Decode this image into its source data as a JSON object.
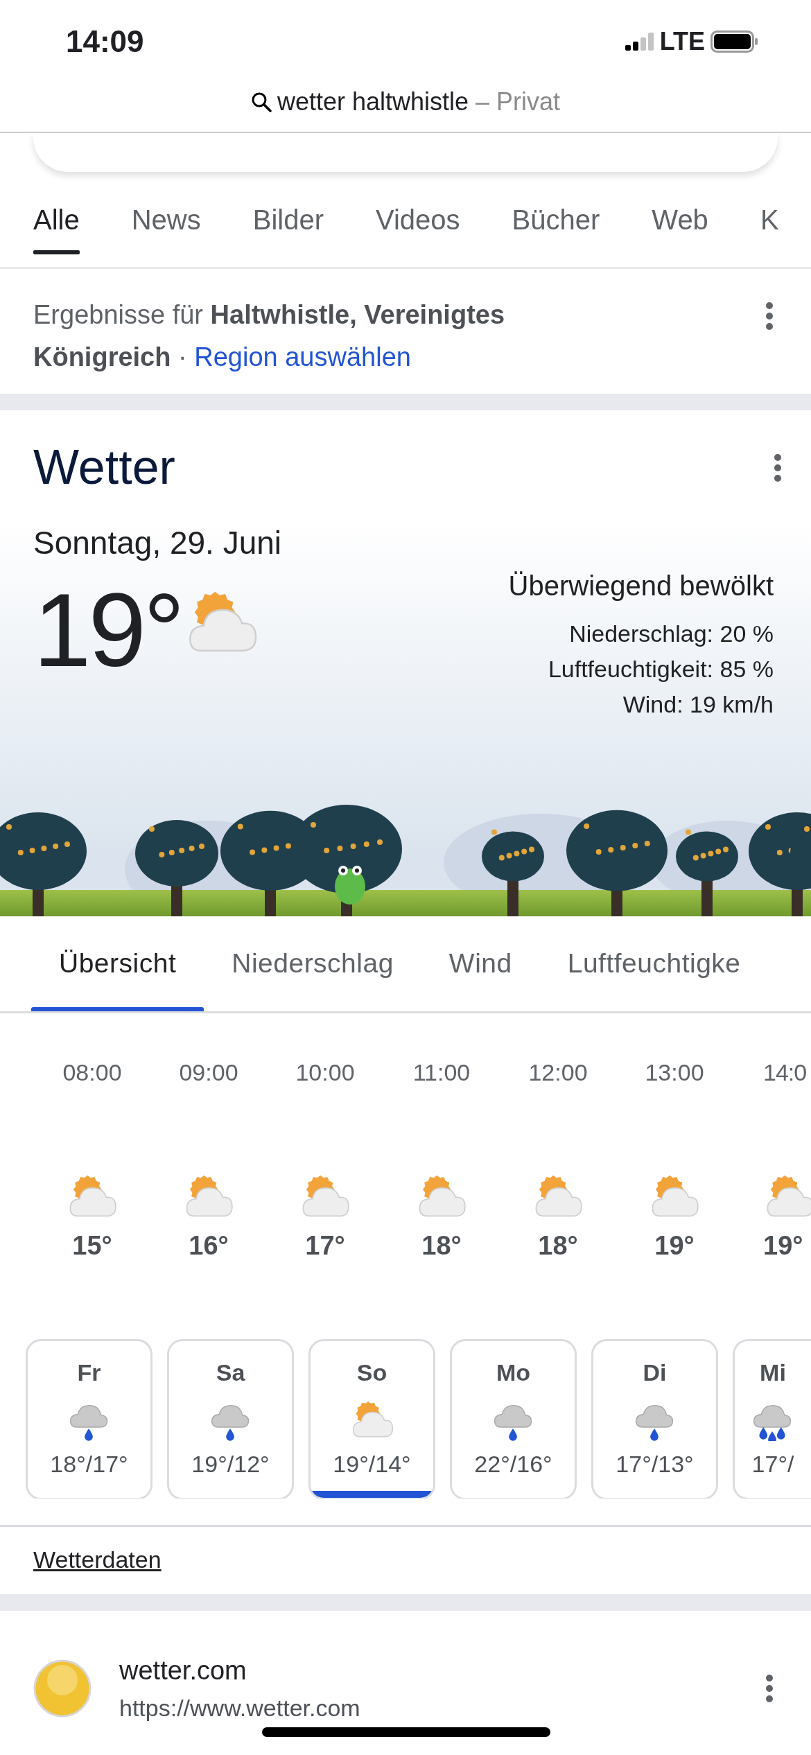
{
  "status_bar": {
    "time": "14:09",
    "network": "LTE"
  },
  "address_bar": {
    "query": "wetter haltwhistle",
    "mode": "– Privat"
  },
  "search_tabs": [
    {
      "label": "Alle",
      "selected": true
    },
    {
      "label": "News",
      "selected": false
    },
    {
      "label": "Bilder",
      "selected": false
    },
    {
      "label": "Videos",
      "selected": false
    },
    {
      "label": "Bücher",
      "selected": false
    },
    {
      "label": "Web",
      "selected": false
    },
    {
      "label": "K",
      "selected": false
    }
  ],
  "results_note": {
    "text": "Ergebnisse für **Haltwhistle, Vereinigtes Königreich** · ",
    "link": "Region auswählen"
  },
  "weather": {
    "title": "Wetter",
    "date": "Sonntag, 29. Juni",
    "temperature": "19°",
    "kind": "partly_cloudy",
    "condition": "Überwiegend bewölkt",
    "details": [
      "Niederschlag: 20 %",
      "Luftfeuchtigkeit: 85 %",
      "Wind: 19 km/h"
    ],
    "tabs": [
      {
        "label": "Übersicht",
        "selected": true
      },
      {
        "label": "Niederschlag",
        "selected": false
      },
      {
        "label": "Wind",
        "selected": false
      },
      {
        "label": "Luftfeuchtigke",
        "selected": false
      }
    ],
    "hourly": [
      {
        "time": "08:00",
        "kind": "partly_cloudy",
        "temp": "15°"
      },
      {
        "time": "09:00",
        "kind": "partly_cloudy",
        "temp": "16°"
      },
      {
        "time": "10:00",
        "kind": "partly_cloudy",
        "temp": "17°"
      },
      {
        "time": "11:00",
        "kind": "partly_cloudy",
        "temp": "18°"
      },
      {
        "time": "12:00",
        "kind": "partly_cloudy",
        "temp": "18°"
      },
      {
        "time": "13:00",
        "kind": "partly_cloudy",
        "temp": "19°"
      },
      {
        "time": "14:0",
        "kind": "partly_cloudy",
        "temp": "19°"
      }
    ],
    "days": [
      {
        "day": "Fr",
        "kind": "rain",
        "temps": "18°/17°",
        "selected": false
      },
      {
        "day": "Sa",
        "kind": "rain",
        "temps": "19°/12°",
        "selected": false
      },
      {
        "day": "So",
        "kind": "partly_cloudy",
        "temps": "19°/14°",
        "selected": true
      },
      {
        "day": "Mo",
        "kind": "rain",
        "temps": "22°/16°",
        "selected": false
      },
      {
        "day": "Di",
        "kind": "rain",
        "temps": "17°/13°",
        "selected": false
      },
      {
        "day": "Mi",
        "kind": "heavy_rain",
        "temps": "17°/",
        "selected": false
      }
    ],
    "source_link": "Wetterdaten"
  },
  "result": {
    "site": "wetter.com",
    "url": "https://www.wetter.com"
  }
}
